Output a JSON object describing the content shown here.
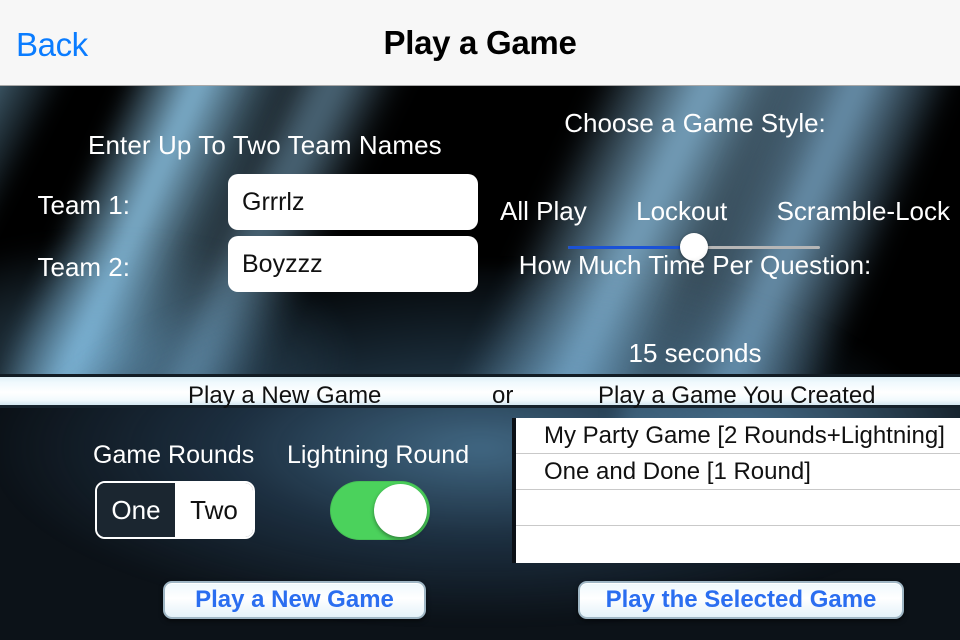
{
  "navbar": {
    "back_label": "Back",
    "title": "Play a Game"
  },
  "setup": {
    "team_heading": "Enter Up To Two Team Names",
    "team1_label": "Team 1:",
    "team1_value": "Grrrlz",
    "team1_placeholder": "",
    "team2_label": "Team 2:",
    "team2_value": "Boyzzz",
    "team2_placeholder": ""
  },
  "game_style": {
    "label": "Choose a Game Style:",
    "options": [
      "All Play",
      "Lockout",
      "Scramble-Lock"
    ],
    "selected": "Lockout",
    "slider_percent": 50
  },
  "time_per_question": {
    "label": "How Much Time Per Question:",
    "value_text": "15 seconds",
    "slider_percent": 48
  },
  "divider": {
    "left": "Play a New Game",
    "conjunction": "or",
    "right": "Play a Game You Created"
  },
  "rounds": {
    "label": "Game Rounds",
    "options": [
      "One",
      "Two"
    ],
    "selected": "One"
  },
  "lightning": {
    "label": "Lightning Round",
    "state": "on",
    "on_color": "#4bd25c"
  },
  "saved_games": {
    "rows": [
      "My Party Game [2 Rounds+Lightning]",
      "One and Done [1 Round]",
      "",
      ""
    ]
  },
  "buttons": {
    "play_new": "Play a New Game",
    "play_selected": "Play the Selected Game",
    "text_color": "#2b6ef0"
  }
}
